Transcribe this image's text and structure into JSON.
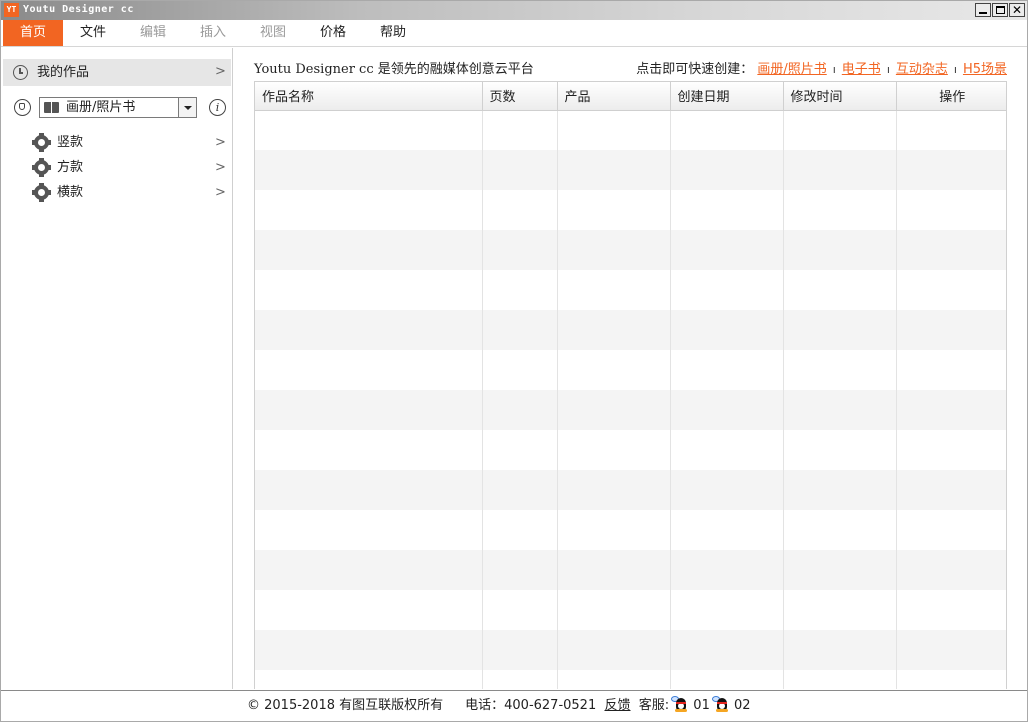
{
  "window": {
    "logo_text": "YT",
    "title": "Youtu Designer cc"
  },
  "menu": [
    {
      "label": "首页",
      "state": "active"
    },
    {
      "label": "文件",
      "state": "normal"
    },
    {
      "label": "编辑",
      "state": "disabled"
    },
    {
      "label": "插入",
      "state": "disabled"
    },
    {
      "label": "视图",
      "state": "disabled"
    },
    {
      "label": "价格",
      "state": "normal"
    },
    {
      "label": "帮助",
      "state": "normal"
    }
  ],
  "sidebar": {
    "my_works_label": "我的作品",
    "product_select": {
      "value": "画册/照片书"
    },
    "style_items": [
      {
        "label": "竖款"
      },
      {
        "label": "方款"
      },
      {
        "label": "横款"
      }
    ]
  },
  "main": {
    "slogan_prefix": "Youtu Designer cc",
    "slogan_suffix": " 是领先的融媒体创意云平台",
    "quick_create_label": "点击即可快速创建：",
    "quick_links": [
      "画册/照片书",
      "电子书",
      "互动杂志",
      "H5场景"
    ],
    "quick_separator": "ı"
  },
  "table": {
    "columns": [
      "作品名称",
      "页数",
      "产品",
      "创建日期",
      "修改时间",
      "操作"
    ],
    "rows": []
  },
  "status": {
    "copyright": "© 2015-2018 有图互联版权所有",
    "phone": "电话：400-627-0521",
    "feedback": "反馈",
    "support_label": "客服:",
    "support_1": "01",
    "support_2": "02"
  },
  "colors": {
    "accent": "#f26522",
    "active_menu_text": "#ffffff",
    "sidebar_selected_bg": "#e6e6e6",
    "table_stripe": "#f4f4f4"
  },
  "icons": {
    "my_works": "clock-icon",
    "filter": "shield-icon",
    "product": "book-icon",
    "info": "info-icon",
    "style": "gear-icon",
    "support": "qq-penguin-icon"
  }
}
